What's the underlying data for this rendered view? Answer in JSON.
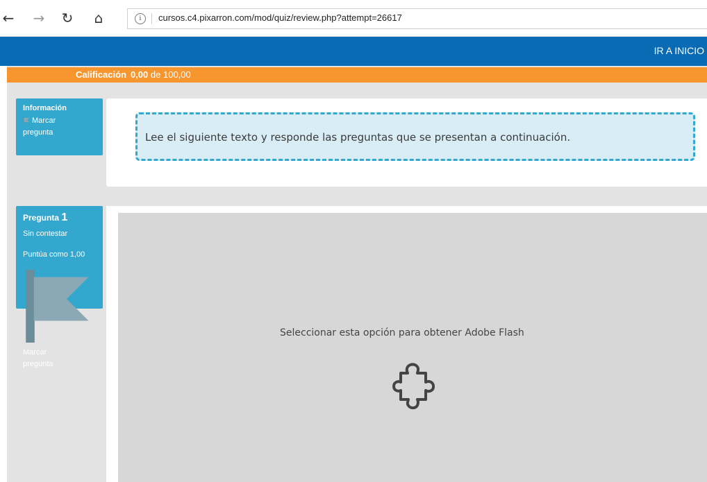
{
  "browser": {
    "url": "cursos.c4.pixarron.com/mod/quiz/review.php?attempt=26617",
    "back_glyph": "←",
    "forward_glyph": "→",
    "refresh_glyph": "↻",
    "home_glyph": "⌂"
  },
  "header": {
    "link_label": "IR A INICIO"
  },
  "grade": {
    "label": "Calificación",
    "value": "0,00",
    "rest": "de 100,00"
  },
  "info_block": {
    "title": "Información",
    "flag_line1": "Marcar",
    "flag_line2": "pregunta",
    "notice_text": "Lee el siguiente texto y responde las preguntas que se presentan a continuación."
  },
  "question": {
    "title": "Pregunta",
    "number": "1",
    "status": "Sin contestar",
    "score": "Puntúa como 1,00",
    "flag_line1": "Marcar",
    "flag_line2": "pregunta"
  },
  "flash": {
    "message": "Seleccionar esta opción para obtener Adobe Flash",
    "icon": "puzzle-icon"
  },
  "colors": {
    "header_blue": "#0a6bb5",
    "grade_orange": "#f7962f",
    "info_blue": "#34a7cf",
    "notice_bg": "#d9edf6",
    "flash_bg": "#d7d7d7"
  }
}
